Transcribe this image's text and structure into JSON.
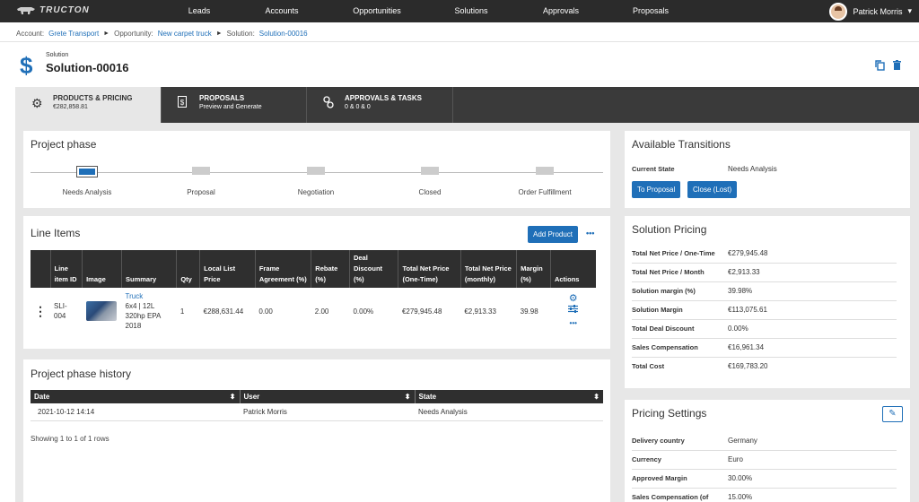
{
  "app": {
    "logo_text": "TRUCTON"
  },
  "nav": {
    "items": [
      "Leads",
      "Accounts",
      "Opportunities",
      "Solutions",
      "Approvals",
      "Proposals"
    ],
    "user_name": "Patrick Morris",
    "user_caret": "▾"
  },
  "breadcrumb": {
    "account_label": "Account:",
    "account_value": "Grete Transport",
    "sep1": "►",
    "opportunity_label": "Opportunity:",
    "opportunity_value": "New carpet truck",
    "sep2": "►",
    "solution_label": "Solution:",
    "solution_value": "Solution-00016"
  },
  "header": {
    "subtitle": "Solution",
    "title": "Solution-00016",
    "icon": "$"
  },
  "tabs": [
    {
      "title": "PRODUCTS & PRICING",
      "sub": "€282,858.81"
    },
    {
      "title": "PROPOSALS",
      "sub": "Preview and Generate"
    },
    {
      "title": "APPROVALS & TASKS",
      "sub": "0 & 0 & 0"
    }
  ],
  "project_phase": {
    "title": "Project phase",
    "steps": [
      "Needs Analysis",
      "Proposal",
      "Negotiation",
      "Closed",
      "Order Fulfillment"
    ],
    "current": "Needs Analysis"
  },
  "line_items": {
    "title": "Line Items",
    "add_button": "Add Product",
    "more_icon": "•••",
    "columns": [
      "",
      "Line item ID",
      "Image",
      "Summary",
      "Qty",
      "Local List Price",
      "Frame Agreement (%)",
      "Rebate (%)",
      "Deal Discount (%)",
      "Total Net Price (One-Time)",
      "Total Net Price (monthly)",
      "Margin (%)",
      "Actions"
    ],
    "rows": [
      {
        "handle": "⋮",
        "id": "SLI-004",
        "summary_link": "Truck",
        "summary_text": "6x4 | 12L 320hp EPA 2018",
        "qty": "1",
        "list_price": "€288,631.44",
        "frame": "0.00",
        "rebate": "2.00",
        "discount": "0.00%",
        "net_one_time": "€279,945.48",
        "net_monthly": "€2,913.33",
        "margin": "39.98"
      }
    ]
  },
  "history": {
    "title": "Project phase history",
    "columns": [
      "Date",
      "User",
      "State"
    ],
    "sort_glyph": "⬍",
    "rows": [
      {
        "date": "2021-10-12 14:14",
        "user": "Patrick Morris",
        "state": "Needs Analysis"
      }
    ],
    "footer": "Showing 1 to 1 of 1 rows"
  },
  "transitions": {
    "title": "Available Transitions",
    "state_label": "Current State",
    "state_value": "Needs Analysis",
    "buttons": [
      "To Proposal",
      "Close (Lost)"
    ]
  },
  "pricing": {
    "title": "Solution Pricing",
    "rows": [
      {
        "k": "Total Net Price / One-Time",
        "v": "€279,945.48"
      },
      {
        "k": "Total Net Price / Month",
        "v": "€2,913.33"
      },
      {
        "k": "Solution margin (%)",
        "v": "39.98%"
      },
      {
        "k": "Solution Margin",
        "v": "€113,075.61"
      },
      {
        "k": "Total Deal Discount",
        "v": "0.00%"
      },
      {
        "k": "Sales Compensation",
        "v": "€16,961.34"
      },
      {
        "k": "Total Cost",
        "v": "€169,783.20"
      }
    ]
  },
  "settings": {
    "title": "Pricing Settings",
    "edit_icon": "✎",
    "rows": [
      {
        "k": "Delivery country",
        "v": "Germany",
        "link": true
      },
      {
        "k": "Currency",
        "v": "Euro",
        "link": true
      },
      {
        "k": "Approved Margin",
        "v": "30.00%",
        "link": false
      },
      {
        "k": "Sales Compensation (of",
        "v": "15.00%",
        "link": false
      }
    ]
  },
  "colors": {
    "accent": "#1f6fb8",
    "nav_bg": "#2b2b2b",
    "page_bg": "#e7e7e7"
  }
}
